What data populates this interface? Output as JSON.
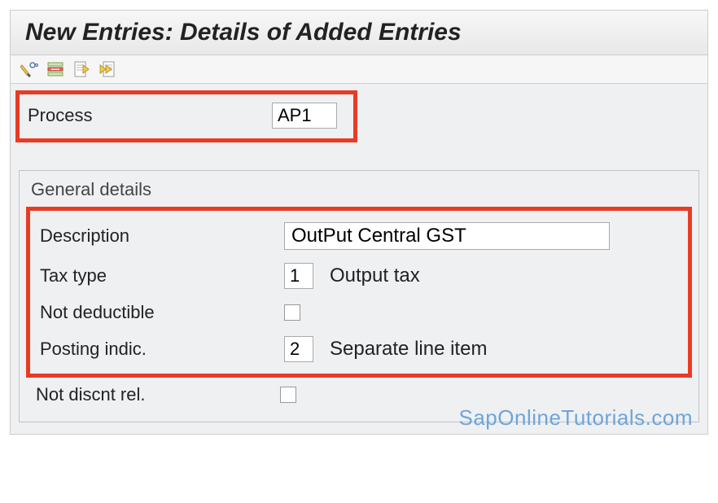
{
  "title": "New Entries: Details of Added Entries",
  "toolbar": {
    "icons": [
      "edit-glasses-icon",
      "delete-row-icon",
      "previous-entry-icon",
      "next-entry-icon"
    ]
  },
  "process": {
    "label": "Process",
    "value": "AP1"
  },
  "group": {
    "title": "General details",
    "description": {
      "label": "Description",
      "value": "OutPut Central GST"
    },
    "tax_type": {
      "label": "Tax type",
      "value": "1",
      "text": "Output tax"
    },
    "not_deductible": {
      "label": "Not deductible",
      "checked": false
    },
    "posting_indic": {
      "label": "Posting indic.",
      "value": "2",
      "text": "Separate line item"
    },
    "not_discnt_rel": {
      "label": "Not discnt rel.",
      "checked": false
    }
  },
  "watermark": "SapOnlineTutorials.com"
}
